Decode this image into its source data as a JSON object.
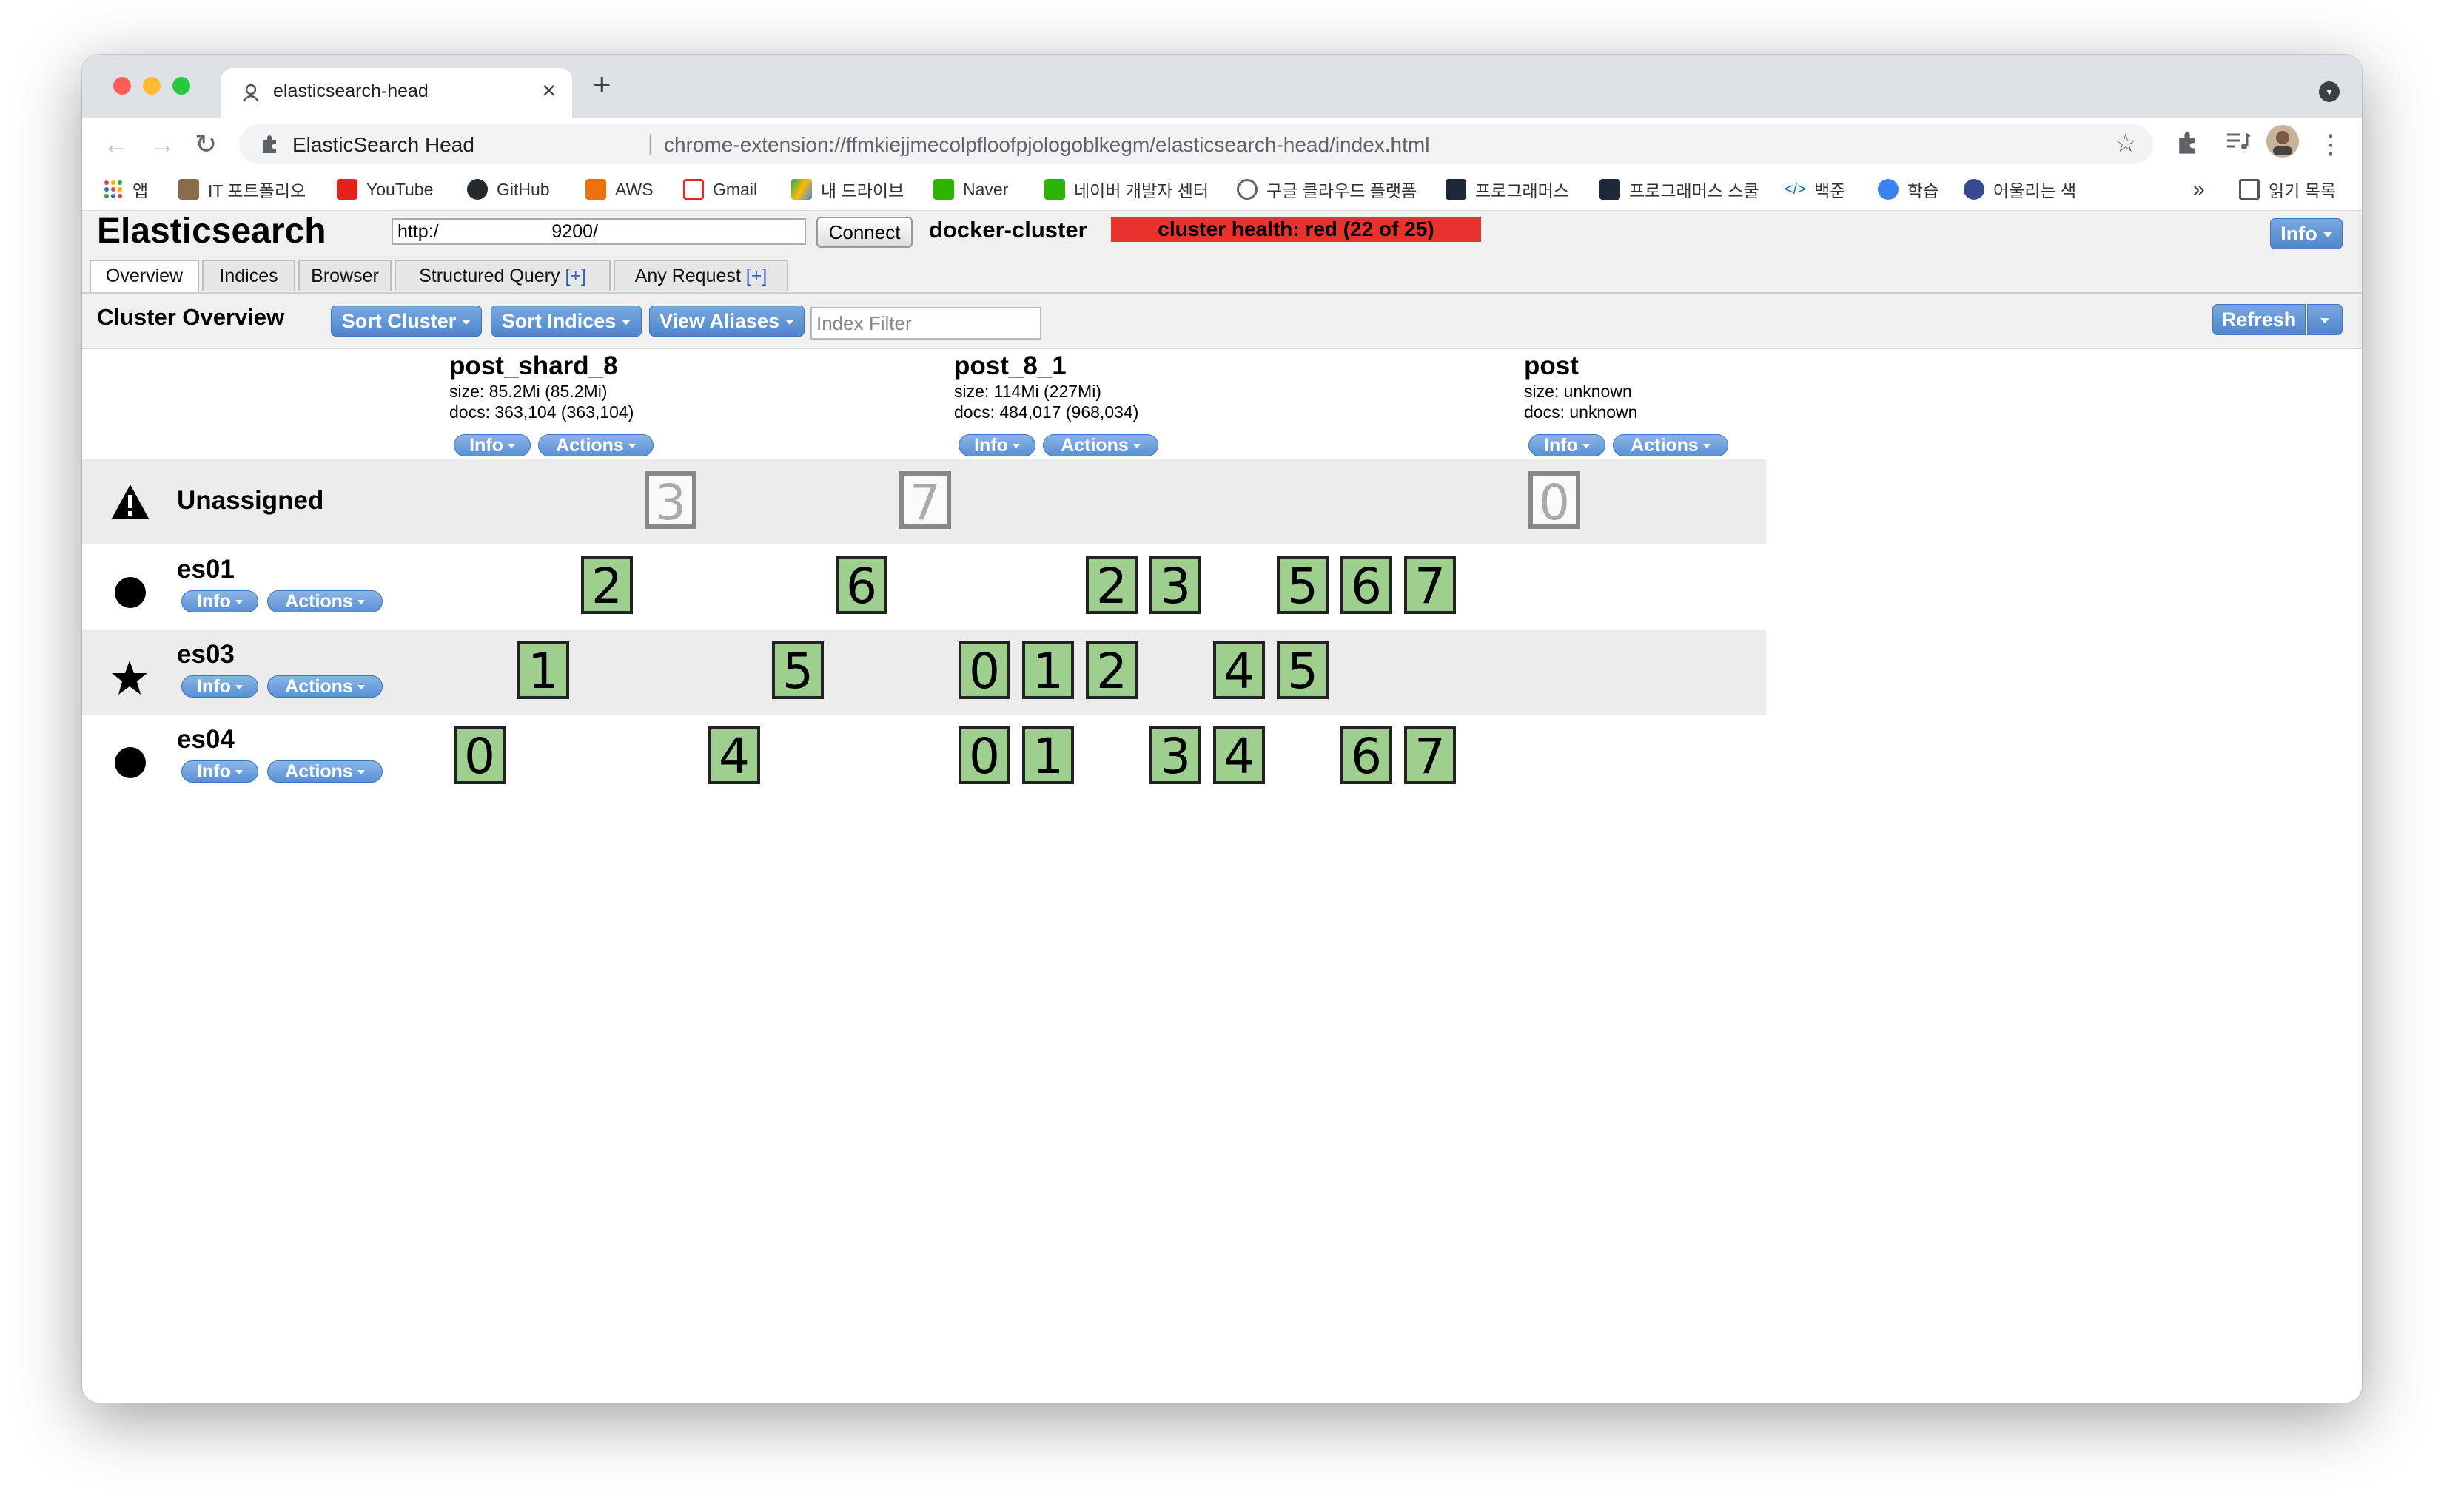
{
  "browser": {
    "tab_title": "elasticsearch-head",
    "new_tab": "+",
    "omnibox_name": "ElasticSearch Head",
    "omnibox_sep": "|",
    "url": "chrome-extension://ffmkiejjmecolpfloofpjologoblkegm/elasticsearch-head/index.html",
    "bookmarks": [
      "앱",
      "IT 포트폴리오",
      "YouTube",
      "GitHub",
      "AWS",
      "Gmail",
      "내 드라이브",
      "Naver",
      "네이버 개발자 센터",
      "구글 클라우드 플랫폼",
      "프로그래머스",
      "프로그래머스 스쿨",
      "백준",
      "학습",
      "어울리는 색"
    ],
    "bookmarks_more": "»",
    "reading_list": "읽기 목록"
  },
  "es": {
    "title": "Elasticsearch",
    "url_value": "http:/                      9200/",
    "connect_label": "Connect",
    "cluster_name": "docker-cluster",
    "cluster_health": "cluster health: red (22 of 25)",
    "info_label": "Info",
    "tabs": [
      {
        "label": "Overview",
        "plus": ""
      },
      {
        "label": "Indices",
        "plus": ""
      },
      {
        "label": "Browser",
        "plus": ""
      },
      {
        "label": "Structured Query ",
        "plus": "[+]"
      },
      {
        "label": "Any Request ",
        "plus": "[+]"
      }
    ],
    "overview_title": "Cluster Overview",
    "sort_cluster": "Sort Cluster",
    "sort_indices": "Sort Indices",
    "view_aliases": "View Aliases",
    "index_filter_placeholder": "Index Filter",
    "refresh": "Refresh",
    "pill_info": "Info",
    "pill_actions": "Actions"
  },
  "indices": [
    {
      "name": "post_shard_8",
      "size": "size: 85.2Mi (85.2Mi)",
      "docs": "docs: 363,104 (363,104)"
    },
    {
      "name": "post_8_1",
      "size": "size: 114Mi (227Mi)",
      "docs": "docs: 484,017 (968,034)"
    },
    {
      "name": "post",
      "size": "size: unknown",
      "docs": "docs: unknown"
    }
  ],
  "nodes": [
    {
      "name": "Unassigned",
      "icon": "warning-icon",
      "shards": [
        {
          "index": 0,
          "shard": "3"
        },
        {
          "index": 0,
          "shard": "7"
        },
        {
          "index": 2,
          "shard": "0"
        }
      ]
    },
    {
      "name": "es01",
      "icon": "circle-icon",
      "shards": [
        {
          "index": 0,
          "shard": "2"
        },
        {
          "index": 0,
          "shard": "6"
        },
        {
          "index": 1,
          "shard": "2"
        },
        {
          "index": 1,
          "shard": "3"
        },
        {
          "index": 1,
          "shard": "5"
        },
        {
          "index": 1,
          "shard": "6"
        },
        {
          "index": 1,
          "shard": "7"
        }
      ]
    },
    {
      "name": "es03",
      "icon": "star-icon",
      "shards": [
        {
          "index": 0,
          "shard": "1"
        },
        {
          "index": 0,
          "shard": "5"
        },
        {
          "index": 1,
          "shard": "0"
        },
        {
          "index": 1,
          "shard": "1"
        },
        {
          "index": 1,
          "shard": "2"
        },
        {
          "index": 1,
          "shard": "4"
        },
        {
          "index": 1,
          "shard": "5"
        }
      ]
    },
    {
      "name": "es04",
      "icon": "circle-icon",
      "shards": [
        {
          "index": 0,
          "shard": "0"
        },
        {
          "index": 0,
          "shard": "4"
        },
        {
          "index": 1,
          "shard": "0"
        },
        {
          "index": 1,
          "shard": "1"
        },
        {
          "index": 1,
          "shard": "3"
        },
        {
          "index": 1,
          "shard": "4"
        },
        {
          "index": 1,
          "shard": "6"
        },
        {
          "index": 1,
          "shard": "7"
        }
      ]
    }
  ],
  "colors": {
    "assigned_shard": "#9ecf8e",
    "health_red": "#e8322e",
    "button_blue": "#5b90d6"
  }
}
